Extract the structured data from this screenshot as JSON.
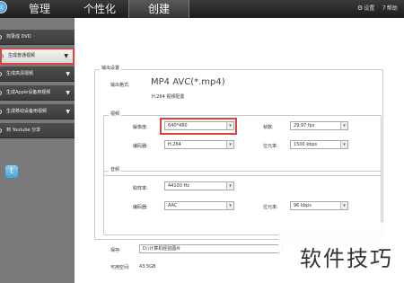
{
  "header": {
    "tabs": [
      {
        "label": "管理"
      },
      {
        "label": "个性化"
      },
      {
        "label": "创建"
      }
    ],
    "settings_label": "设置",
    "help_label": "帮助",
    "icons": {
      "settings": "gear-icon",
      "help": "question-icon"
    }
  },
  "sidebar": {
    "items": [
      {
        "label": "刻录成 DVD"
      },
      {
        "label": "生成普通视频"
      },
      {
        "label": "生成高清视频"
      },
      {
        "label": "生成Apple设备用视频"
      },
      {
        "label": "生成移动设备用视频"
      },
      {
        "label": "到 Youtube 分享"
      }
    ],
    "share_icon": "twitter-icon"
  },
  "output": {
    "group_title": "输出设置",
    "format_label": "输出格式:",
    "format_value": "MP4 AVC(*.mp4)",
    "format_sub": "H.264 视频配置"
  },
  "video": {
    "group_title": "视频",
    "resolution_label": "解像度:",
    "resolution_value": "640*480",
    "framerate_label": "帧数:",
    "framerate_value": "29.97 fps",
    "encoder_label": "编码器:",
    "encoder_value": "H.264",
    "bitrate_label": "位元率:",
    "bitrate_value": "1500 kbps"
  },
  "audio": {
    "group_title": "音频",
    "samplerate_label": "取样率:",
    "samplerate_value": "44100 Hz",
    "encoder_label": "编码器:",
    "encoder_value": "AAC",
    "bitrate_label": "位元率:",
    "bitrate_value": "96 kbps"
  },
  "save": {
    "label": "保存:",
    "path": "D:\\计算机经验图片",
    "space_label": "可用空间:",
    "space_value": "43.5GB"
  },
  "watermark": "软件技巧",
  "colors": {
    "highlight": "#e0413c",
    "topbar": "#2b2b2b",
    "sidebar": "#7a7a7a"
  }
}
